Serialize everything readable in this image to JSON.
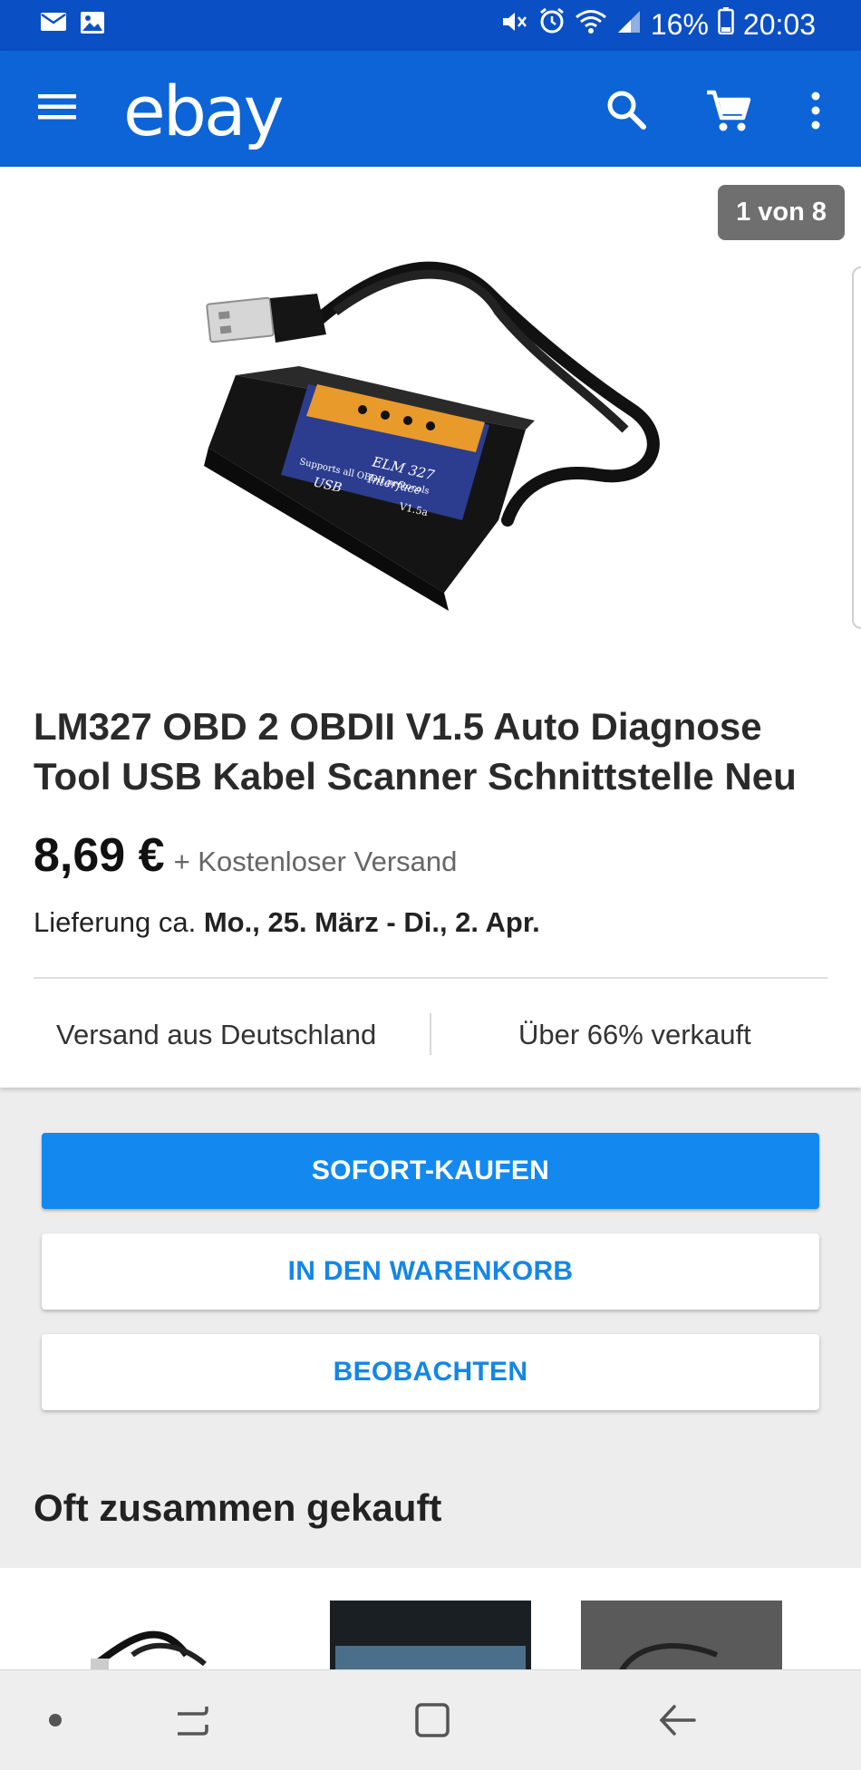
{
  "status_bar": {
    "battery_text": "16%",
    "time": "20:03",
    "left_icons": [
      "mail-icon",
      "image-icon"
    ],
    "right_icons": [
      "mute-icon",
      "alarm-icon",
      "wifi-icon",
      "signal-icon",
      "battery-icon"
    ]
  },
  "app_bar": {
    "logo_text": "ebay",
    "icons": [
      "menu-icon",
      "search-icon",
      "cart-icon",
      "more-vert-icon"
    ]
  },
  "gallery": {
    "counter_text": "1 von 8"
  },
  "product": {
    "title": "LM327 OBD 2 OBDII  V1.5 Auto Diagnose Tool USB Kabel Scanner Schnittstelle Neu",
    "price": "8,69 €",
    "shipping": "+ Kostenloser Versand",
    "delivery_prefix": "Lieferung ca.",
    "delivery_dates": "Mo., 25. März - Di., 2. Apr.",
    "feature_left": "Versand aus Deutschland",
    "feature_right": "Über 66% verkauft"
  },
  "actions": {
    "buy_now": "SOFORT-KAUFEN",
    "add_to_cart": "IN DEN WARENKORB",
    "watch": "BEOBACHTEN"
  },
  "related": {
    "title": "Oft zusammen gekauft"
  },
  "colors": {
    "status_bar": "#0b4fc4",
    "app_bar": "#0c64d6",
    "primary_button": "#1389f0",
    "link_text": "#1486e6"
  }
}
